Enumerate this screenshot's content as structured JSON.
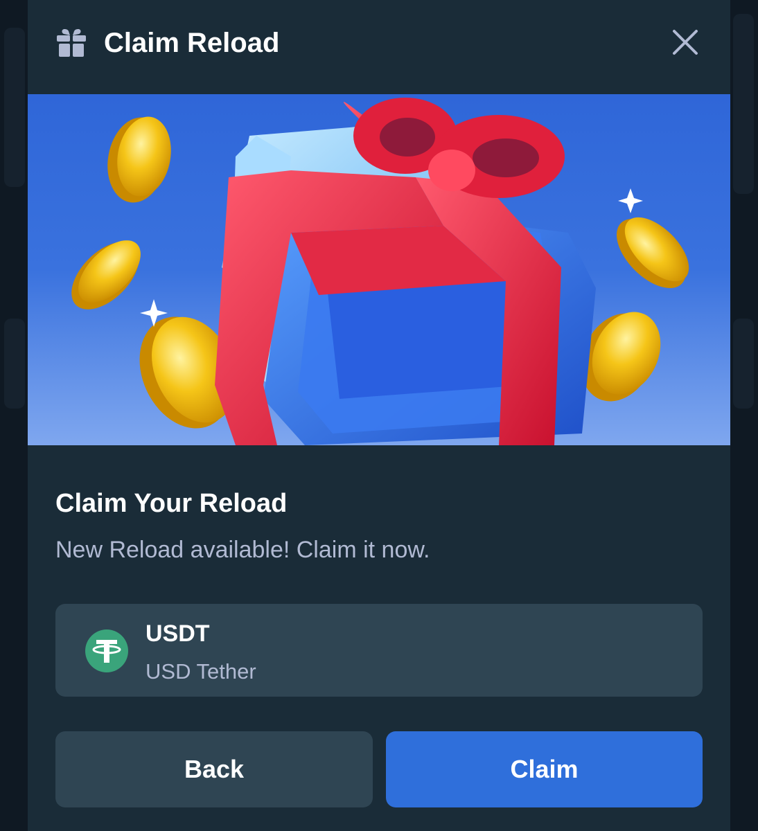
{
  "header": {
    "title": "Claim Reload",
    "icon": "gift-icon",
    "close_icon": "close-icon"
  },
  "banner": {
    "description_icon": "gift-box-with-coins-illustration"
  },
  "content": {
    "title": "Claim Your Reload",
    "subtitle": "New Reload available! Claim it now."
  },
  "currency": {
    "code": "USDT",
    "name": "USD Tether",
    "icon": "tether-icon",
    "icon_color": "#3aa47b"
  },
  "actions": {
    "back_label": "Back",
    "claim_label": "Claim"
  },
  "colors": {
    "modal_bg": "#1a2c38",
    "card_bg": "#2f4553",
    "primary": "#2f6fdb",
    "muted_text": "#b1bad3"
  }
}
